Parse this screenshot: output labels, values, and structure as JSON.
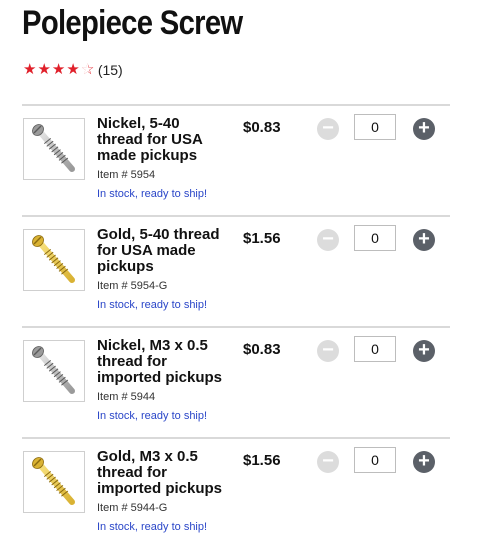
{
  "product": {
    "title": "Polepiece Screw",
    "rating_stars": 4.5,
    "review_count": "(15)"
  },
  "colors": {
    "star": "#e0202a",
    "stock_link": "#2a46c8",
    "plus": "#5b6068",
    "minus": "#dcdcdc"
  },
  "icons": {
    "minus": "minus-circle-icon",
    "plus": "plus-circle-icon"
  },
  "variants": [
    {
      "name_lines": [
        "Nickel, 5-40",
        "thread for USA",
        "made pickups"
      ],
      "item": "Item # 5954",
      "stock": "In stock, ready to ship!",
      "price": "$0.83",
      "quantity": "0",
      "finish": "nickel"
    },
    {
      "name_lines": [
        "Gold, 5-40 thread",
        "for USA made",
        "pickups"
      ],
      "item": "Item # 5954-G",
      "stock": "In stock, ready to ship!",
      "price": "$1.56",
      "quantity": "0",
      "finish": "gold"
    },
    {
      "name_lines": [
        "Nickel, M3 x 0.5",
        "thread for",
        "imported pickups"
      ],
      "item": "Item # 5944",
      "stock": "In stock, ready to ship!",
      "price": "$0.83",
      "quantity": "0",
      "finish": "nickel"
    },
    {
      "name_lines": [
        "Gold, M3 x 0.5",
        "thread for",
        "imported pickups"
      ],
      "item": "Item # 5944-G",
      "stock": "In stock, ready to ship!",
      "price": "$1.56",
      "quantity": "0",
      "finish": "gold"
    }
  ]
}
